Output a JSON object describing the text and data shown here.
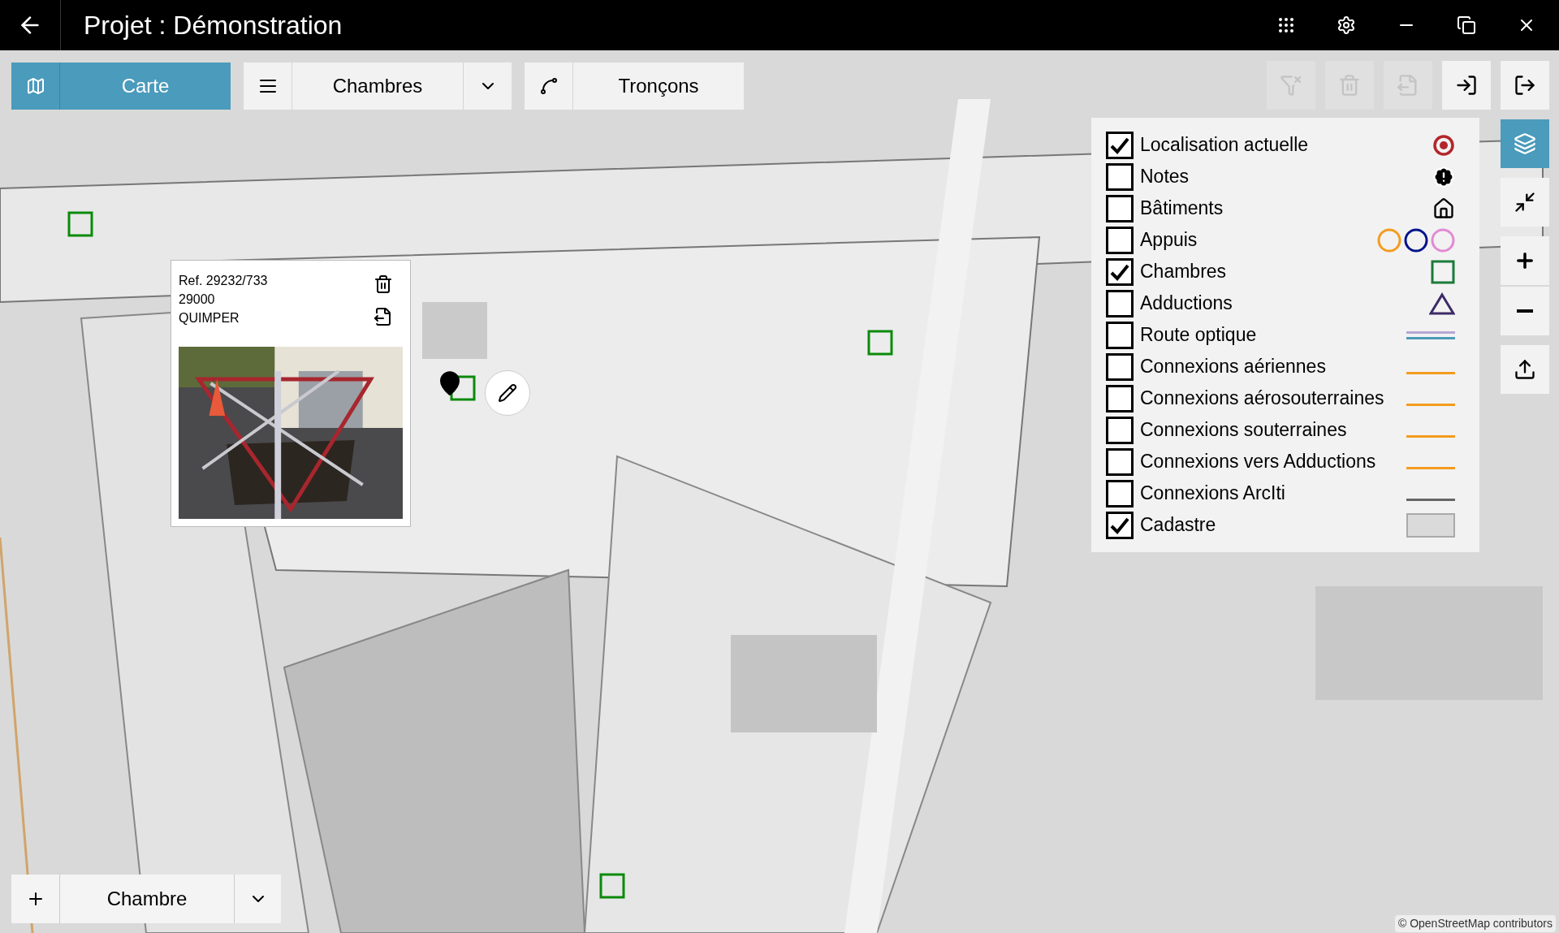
{
  "window": {
    "title": "Projet : Démonstration"
  },
  "title_actions": [
    {
      "kind": "apps"
    },
    {
      "kind": "settings"
    },
    {
      "kind": "minimize"
    },
    {
      "kind": "restore"
    },
    {
      "kind": "close"
    }
  ],
  "view_tabs": [
    {
      "kind": "map",
      "label": "Carte",
      "selected": true
    },
    {
      "kind": "list",
      "label": "Chambres",
      "selected": false
    },
    {
      "kind": "segments",
      "label": "Tronçons",
      "selected": false
    }
  ],
  "actions": [
    {
      "kind": "clear-filter",
      "disabled": true
    },
    {
      "kind": "delete",
      "disabled": true
    },
    {
      "kind": "export",
      "disabled": true
    },
    {
      "kind": "import",
      "disabled": false
    },
    {
      "kind": "logout",
      "disabled": false
    }
  ],
  "legend": {
    "items": [
      {
        "label": "Localisation actuelle",
        "checked": true,
        "kind": "target"
      },
      {
        "label": "Notes",
        "checked": false,
        "kind": "note"
      },
      {
        "label": "Bâtiments",
        "checked": false,
        "kind": "home"
      },
      {
        "label": "Appuis",
        "checked": false,
        "kind": "circles"
      },
      {
        "label": "Chambres",
        "checked": true,
        "kind": "square"
      },
      {
        "label": "Adductions",
        "checked": false,
        "kind": "triangle"
      },
      {
        "label": "Route optique",
        "checked": false,
        "kind": "double-line"
      },
      {
        "label": "Connexions aériennes",
        "checked": false,
        "kind": "orange-line"
      },
      {
        "label": "Connexions aérosouterraines",
        "checked": false,
        "kind": "orange-line"
      },
      {
        "label": "Connexions souterraines",
        "checked": false,
        "kind": "orange-line"
      },
      {
        "label": "Connexions vers Adductions",
        "checked": false,
        "kind": "orange-line"
      },
      {
        "label": "Connexions ArcIti",
        "checked": false,
        "kind": "gray-line"
      },
      {
        "label": "Cadastre",
        "checked": true,
        "kind": "fill"
      }
    ]
  },
  "map_tools": [
    {
      "kind": "layers",
      "selected": true
    },
    {
      "kind": "fit",
      "selected": false
    },
    {
      "kind": "zoom-in",
      "selected": false
    },
    {
      "kind": "zoom-out",
      "selected": false
    },
    {
      "kind": "share",
      "selected": false
    }
  ],
  "popup": {
    "lines": [
      "Ref. 29232/733",
      "29000",
      "QUIMPER"
    ]
  },
  "add_bar": {
    "value": "Chambre"
  },
  "attribution": "© OpenStreetMap contributors"
}
